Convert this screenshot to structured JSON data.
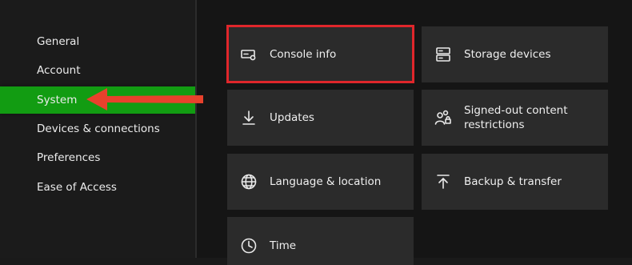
{
  "sidebar": {
    "items": [
      {
        "label": "General"
      },
      {
        "label": "Account"
      },
      {
        "label": "System",
        "selected": true
      },
      {
        "label": "Devices & connections"
      },
      {
        "label": "Preferences"
      },
      {
        "label": "Ease of Access"
      }
    ]
  },
  "tiles": {
    "console_info": {
      "label": "Console info",
      "icon": "console-icon"
    },
    "storage_devices": {
      "label": "Storage devices",
      "icon": "storage-icon"
    },
    "updates": {
      "label": "Updates",
      "icon": "download-arrow-icon"
    },
    "signed_out": {
      "label": "Signed-out content restrictions",
      "icon": "people-lock-icon"
    },
    "language": {
      "label": "Language & location",
      "icon": "globe-icon"
    },
    "backup": {
      "label": "Backup & transfer",
      "icon": "upload-arrow-icon"
    },
    "time": {
      "label": "Time",
      "icon": "clock-icon"
    }
  },
  "colors": {
    "selected_nav": "#129c12",
    "highlight_border": "#e0262b",
    "arrow": "#e8412c",
    "tile": "#2b2b2b"
  }
}
